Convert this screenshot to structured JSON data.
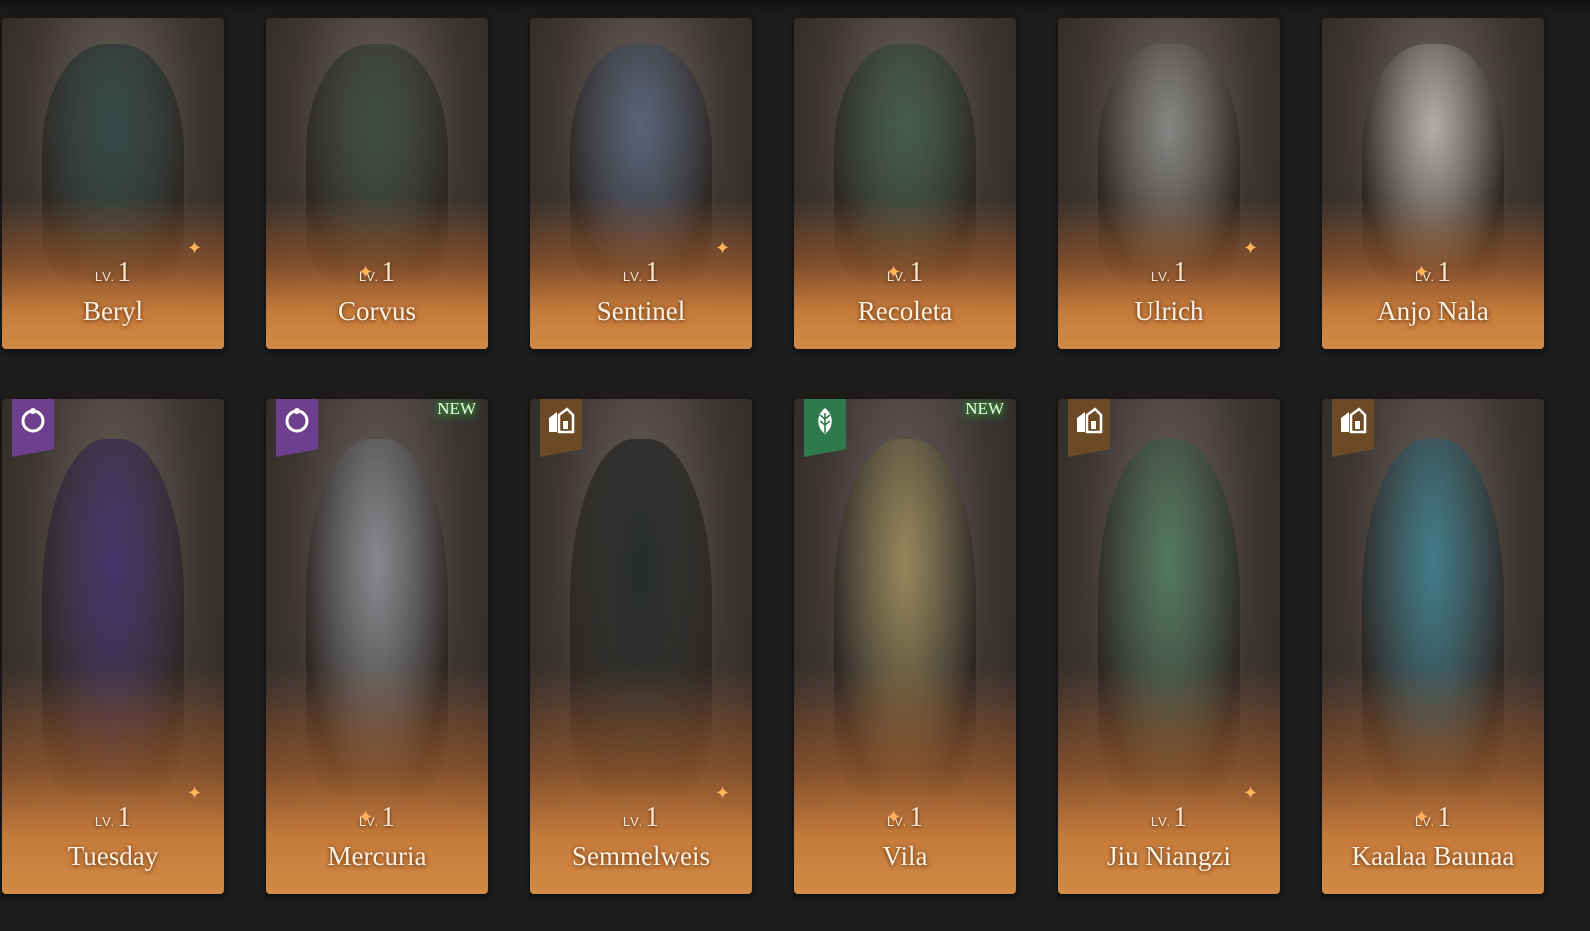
{
  "lv_prefix": "LV.",
  "top_row": [
    {
      "name": "Beryl",
      "level": "1",
      "palette": "#2b4743"
    },
    {
      "name": "Corvus",
      "level": "1",
      "palette": "#3b4a3e"
    },
    {
      "name": "Sentinel",
      "level": "1",
      "palette": "#56627c"
    },
    {
      "name": "Recoleta",
      "level": "1",
      "palette": "#3f5c4e"
    },
    {
      "name": "Ulrich",
      "level": "1",
      "palette": "#8a8a88"
    },
    {
      "name": "Anjo Nala",
      "level": "1",
      "palette": "#b9b7b2"
    }
  ],
  "bottom_row": [
    {
      "name": "Tuesday",
      "level": "1",
      "tag": "purple",
      "tag_icon": "moon-icon",
      "new": false,
      "palette": "#3d2f6b"
    },
    {
      "name": "Mercuria",
      "level": "1",
      "tag": "purple",
      "tag_icon": "moon-icon",
      "new": true,
      "palette": "#8a8d93"
    },
    {
      "name": "Semmelweis",
      "level": "1",
      "tag": "brown",
      "tag_icon": "building-icon",
      "new": false,
      "palette": "#1f2624"
    },
    {
      "name": "Vila",
      "level": "1",
      "tag": "green",
      "tag_icon": "leaf-icon",
      "new": true,
      "palette": "#9a8a5a"
    },
    {
      "name": "Jiu Niangzi",
      "level": "1",
      "tag": "brown",
      "tag_icon": "building-icon",
      "new": false,
      "palette": "#4f7a62"
    },
    {
      "name": "Kaalaa Baunaa",
      "level": "1",
      "tag": "brown",
      "tag_icon": "building-icon",
      "new": false,
      "palette": "#3a7e8e"
    }
  ],
  "new_label": "NEW"
}
